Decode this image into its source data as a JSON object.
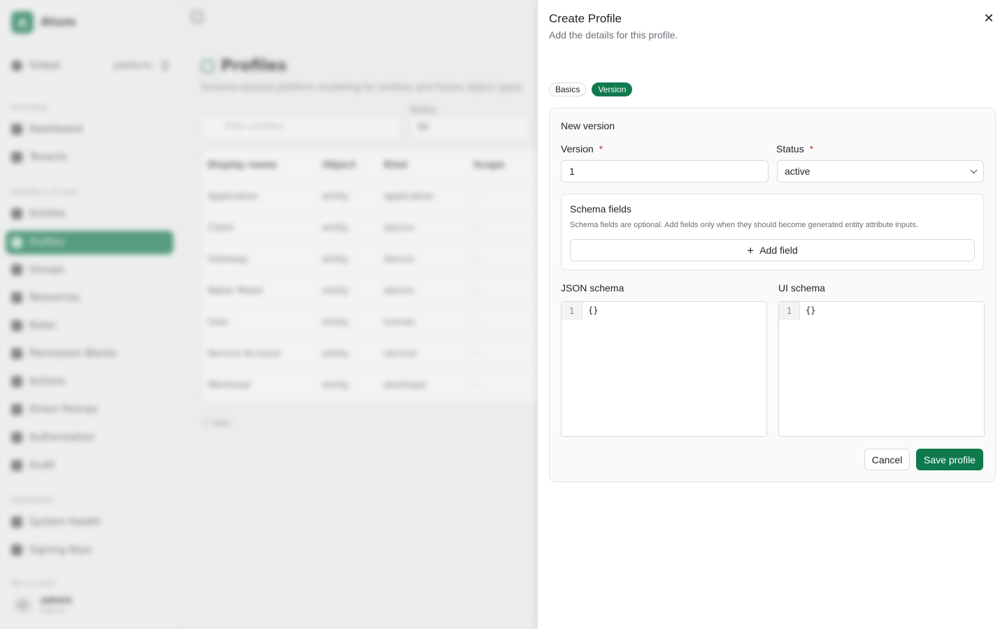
{
  "background": {
    "brand": {
      "logo_glyph": "A",
      "name": "Atom"
    },
    "scope": {
      "label": "Global",
      "tenant": "platform"
    },
    "nav": {
      "section_overview": "Overview",
      "dashboard": "Dashboard",
      "tenants": "Tenants",
      "section_identity": "Identity & Access",
      "entities": "Entities",
      "profiles": "Profiles",
      "groups": "Groups",
      "resources": "Resources",
      "roles": "Roles",
      "permission_blocks": "Permission Blocks",
      "actions": "Actions",
      "direct_policies": "Direct Policies",
      "authorization": "Authorization",
      "audit": "Audit",
      "section_operations": "Operations",
      "system_health": "System Health",
      "signing_keys": "Signing Keys",
      "section_account": "My account"
    },
    "user": {
      "initials": "AD",
      "name": "admin",
      "role": "Owner"
    },
    "page": {
      "title": "Profiles",
      "subtitle": "Schema-backed platform modeling for entities and future object types.",
      "filter_placeholder": "Filter profiles...",
      "status_label": "Status",
      "status_value": "All",
      "columns": [
        "Display name",
        "Object",
        "Kind",
        "Scope"
      ],
      "rows": [
        [
          "Application",
          "entity",
          "application",
          "-"
        ],
        [
          "Client",
          "entity",
          "device",
          "-"
        ],
        [
          "Gateway",
          "entity",
          "device",
          "-"
        ],
        [
          "Water Meter",
          "entity",
          "device",
          "-"
        ],
        [
          "User",
          "entity",
          "human",
          "-"
        ],
        [
          "Service Account",
          "entity",
          "service",
          "-"
        ],
        [
          "Workload",
          "entity",
          "workload",
          "-"
        ]
      ],
      "count": "7 rows"
    }
  },
  "drawer": {
    "title": "Create Profile",
    "description": "Add the details for this profile.",
    "close_glyph": "✕",
    "tabs": [
      {
        "label": "Basics",
        "active": false
      },
      {
        "label": "Version",
        "active": true
      }
    ],
    "section_heading": "New version",
    "version": {
      "label": "Version",
      "required_mark": "*",
      "value": "1"
    },
    "status": {
      "label": "Status",
      "required_mark": "*",
      "value": "active"
    },
    "schema_fields": {
      "title": "Schema fields",
      "help": "Schema fields are optional. Add fields only when they should become generated entity attribute inputs.",
      "add_label": "Add field",
      "add_glyph": "+"
    },
    "json_schema": {
      "label": "JSON schema",
      "line_number": "1",
      "content": "{}"
    },
    "ui_schema": {
      "label": "UI schema",
      "line_number": "1",
      "content": "{}"
    },
    "cancel_label": "Cancel",
    "save_label": "Save profile"
  },
  "colors": {
    "accent": "#0f7a4d",
    "required": "#d92d20"
  },
  "icons": {
    "close": "close-icon",
    "plus": "plus-icon",
    "chevron": "chevron-down-icon"
  }
}
